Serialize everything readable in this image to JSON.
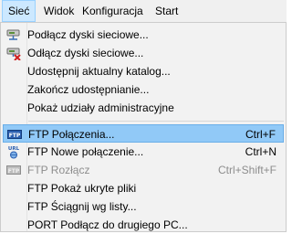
{
  "menubar": {
    "items": [
      "Sieć",
      "Widok",
      "Konfiguracja",
      "Start"
    ]
  },
  "menu": {
    "items": [
      {
        "label": "Podłącz dyski sieciowe...",
        "shortcut": "",
        "icon": "network-drive-connect-icon"
      },
      {
        "label": "Odłącz dyski sieciowe...",
        "shortcut": "",
        "icon": "network-drive-disconnect-icon"
      },
      {
        "label": "Udostępnij aktualny katalog...",
        "shortcut": ""
      },
      {
        "label": "Zakończ udostępnianie...",
        "shortcut": ""
      },
      {
        "label": "Pokaż udziały administracyjne",
        "shortcut": ""
      },
      {
        "label": "FTP Połączenia...",
        "shortcut": "Ctrl+F",
        "icon": "ftp-icon"
      },
      {
        "label": "FTP Nowe połączenie...",
        "shortcut": "Ctrl+N",
        "icon": "url-icon"
      },
      {
        "label": "FTP Rozłącz",
        "shortcut": "Ctrl+Shift+F",
        "icon": "ftp-disconnect-icon"
      },
      {
        "label": "FTP Pokaż ukryte pliki",
        "shortcut": ""
      },
      {
        "label": "FTP Ściągnij wg listy...",
        "shortcut": ""
      },
      {
        "label": "PORT Podłącz do drugiego PC...",
        "shortcut": ""
      }
    ]
  },
  "colors": {
    "highlight": "#91c9f7",
    "menu_background": "#f2f2f2",
    "disabled_text": "#8d8d8d"
  }
}
